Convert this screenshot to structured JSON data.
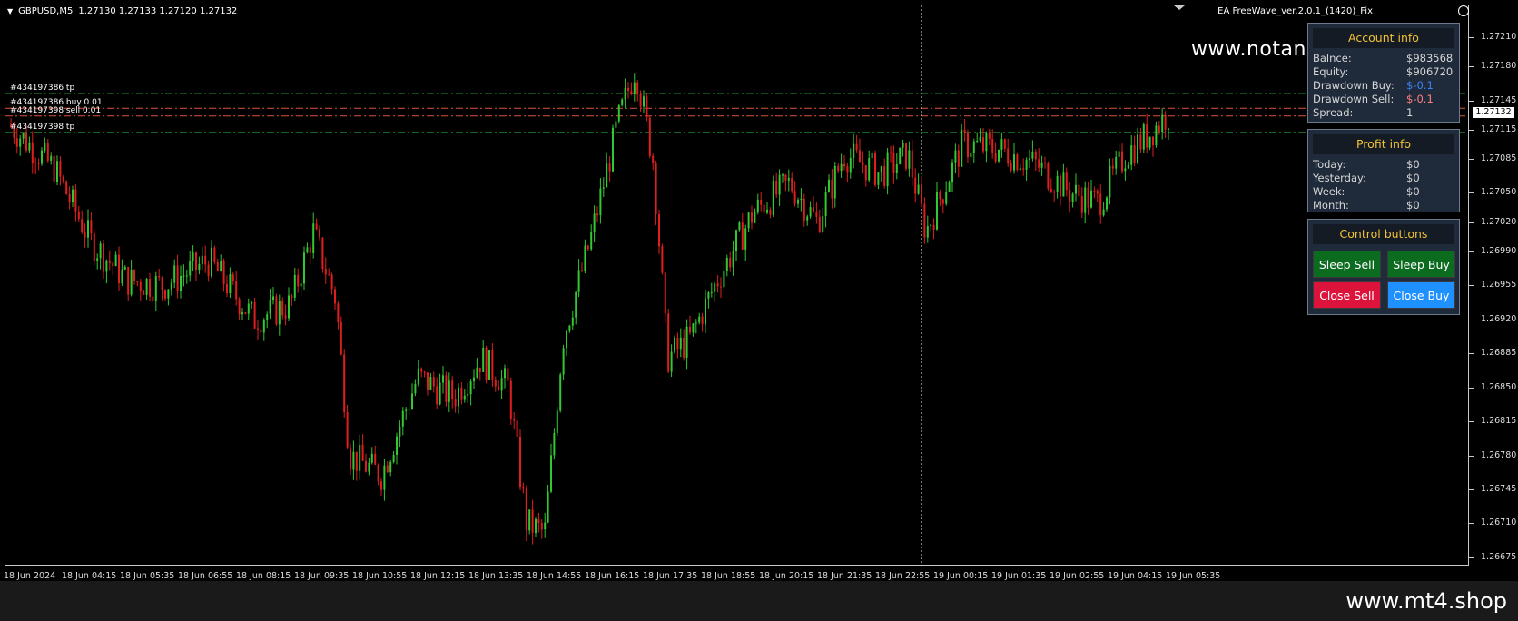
{
  "header": {
    "symbol": "GBPUSD,M5",
    "ohlc": "1.27130 1.27133 1.27120 1.27132",
    "ea_title": "EA FreeWave_ver.2.0.1_(1420)_Fix"
  },
  "watermark_top": "www.notan",
  "watermark_bottom": "www.mt4.shop",
  "order_labels": [
    {
      "text": "#434197386 tp",
      "price": 1.27152,
      "color": "#28c840"
    },
    {
      "text": "#434197386 buy 0.01",
      "price": 1.27137,
      "color": "#e0503c"
    },
    {
      "text": "#434197398 sell 0.01",
      "price": 1.27129,
      "color": "#e0503c"
    },
    {
      "text": "#434197398 tp",
      "price": 1.27112,
      "color": "#28c840"
    }
  ],
  "price_axis": [
    "1.27210",
    "1.27180",
    "1.27145",
    "1.27115",
    "1.27085",
    "1.27050",
    "1.27020",
    "1.26990",
    "1.26955",
    "1.26920",
    "1.26885",
    "1.26850",
    "1.26815",
    "1.26780",
    "1.26745",
    "1.26710",
    "1.26675"
  ],
  "current_price": "1.27132",
  "time_axis": [
    "18 Jun 2024",
    "18 Jun 04:15",
    "18 Jun 05:35",
    "18 Jun 06:55",
    "18 Jun 08:15",
    "18 Jun 09:35",
    "18 Jun 10:55",
    "18 Jun 12:15",
    "18 Jun 13:35",
    "18 Jun 14:55",
    "18 Jun 16:15",
    "18 Jun 17:35",
    "18 Jun 18:55",
    "18 Jun 20:15",
    "18 Jun 21:35",
    "18 Jun 22:55",
    "19 Jun 00:15",
    "19 Jun 01:35",
    "19 Jun 02:55",
    "19 Jun 04:15",
    "19 Jun 05:35"
  ],
  "colors": {
    "bull": "#32c832",
    "bear": "#e01e1e",
    "tp_line": "#28c840",
    "order_line": "#e0503c",
    "accent": "#f2c233"
  },
  "account": {
    "title": "Account info",
    "rows": [
      {
        "label": "Balnce:",
        "value": "$983568",
        "color": "#d6d6d6"
      },
      {
        "label": "Equity:",
        "value": "$906720",
        "color": "#d6d6d6"
      },
      {
        "label": "Drawdown Buy:",
        "value": "$-0.1",
        "color": "#3b82f6"
      },
      {
        "label": "Drawdown Sell:",
        "value": "$-0.1",
        "color": "#ff8080"
      },
      {
        "label": "Spread:",
        "value": "1",
        "color": "#d6d6d6"
      }
    ]
  },
  "profit": {
    "title": "Profit info",
    "rows": [
      {
        "label": "Today:",
        "value": "$0"
      },
      {
        "label": "Yesterday:",
        "value": "$0"
      },
      {
        "label": "Week:",
        "value": "$0"
      },
      {
        "label": "Month:",
        "value": "$0"
      }
    ]
  },
  "controls": {
    "title": "Control buttons",
    "sleep_sell": "Sleep Sell",
    "sleep_buy": "Sleep Buy",
    "close_sell": "Close Sell",
    "close_buy": "Close Buy"
  }
}
